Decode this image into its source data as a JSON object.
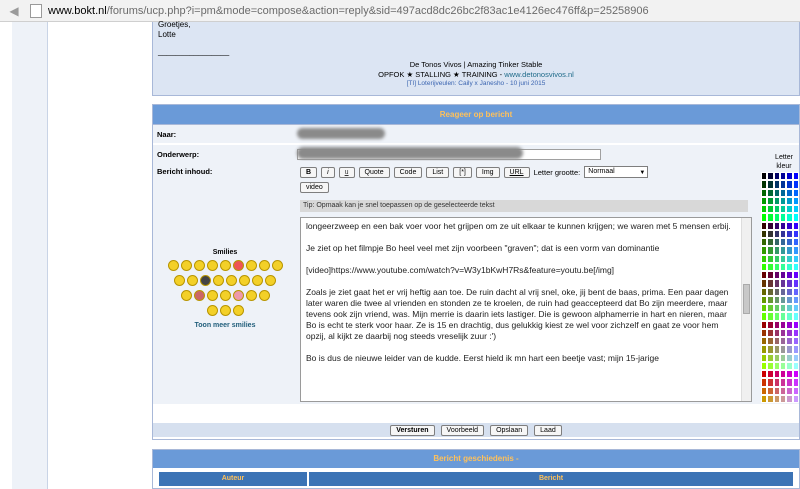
{
  "browser": {
    "url_host": "www.bokt.nl",
    "url_rest": "/forums/ucp.php?i=pm&mode=compose&action=reply&sid=497acd8dc26bc2f83ac1e4126ec476ff&p=25258906"
  },
  "previous_message": {
    "lines": [
      "Groetjes,",
      "Lotte",
      "________________"
    ],
    "signature_line1": "De Tonos Vivos | Amazing Tinker Stable",
    "signature_line2_prefix": "OPFOK ★ STALLING ★ TRAINING - ",
    "signature_link": "www.detonosvivos.nl",
    "signature_line3": "[TI] Loterijveulen: Caily x Janesho - 10 juni 2015"
  },
  "form": {
    "header": "Reageer op bericht",
    "to_label": "Naar:",
    "subject_label": "Onderwerp:",
    "body_label": "Bericht inhoud:",
    "smilies_title": "Smilies",
    "more_smilies": "Toon meer smilies",
    "font_size_label": "Letter grootte:",
    "font_size_value": "Normaal",
    "tip": "Tip: Opmaak kan je snel toepassen op de geselecteerde tekst",
    "color_label": "Letter kleur",
    "toolbar": [
      "B",
      "i",
      "u",
      "Quote",
      "Code",
      "List",
      "[*]",
      "Img",
      "URL"
    ],
    "video_button": "video",
    "message_text": "longeerzweep en een bak voer voor het grijpen om ze uit elkaar te kunnen krijgen; we waren met 5 mensen erbij.\n\nJe ziet op het filmpje Bo heel veel met zijn voorbeen \"graven\"; dat is een vorm van dominantie\n\n[video]https://www.youtube.com/watch?v=W3y1bKwH7Rs&feature=youtu.be[/img]\n\nZoals je ziet gaat het er vrij heftig aan toe. De ruin dacht al vrij snel, oke, jij bent de baas, prima. Een paar dagen later waren die twee al vrienden en stonden ze te kroelen, de ruin had geaccepteerd dat Bo zijn meerdere, maar tevens ook zijn vriend, was. Mijn merrie is daarin iets lastiger. Die is gewoon alphamerrie in hart en nieren, maar Bo is echt te sterk voor haar. Ze is 15 en drachtig, dus gelukkig kiest ze wel voor zichzelf en gaat ze voor hem opzij, al kijkt ze daarbij nog steeds vreselijk zuur :')\n\nBo is dus de nieuwe leider van de kudde. Eerst hield ik mn hart een beetje vast; mijn 15-jarige",
    "buttons": {
      "submit": "Versturen",
      "preview": "Voorbeeld",
      "save": "Opslaan",
      "load": "Laad"
    }
  },
  "history": {
    "header": "Bericht geschiedenis -",
    "col_author": "Auteur",
    "col_message": "Bericht"
  },
  "colors": {
    "header_bg": "#6a9ad8",
    "header_text": "#ffc15a",
    "row_bg": "#eef2f8"
  }
}
